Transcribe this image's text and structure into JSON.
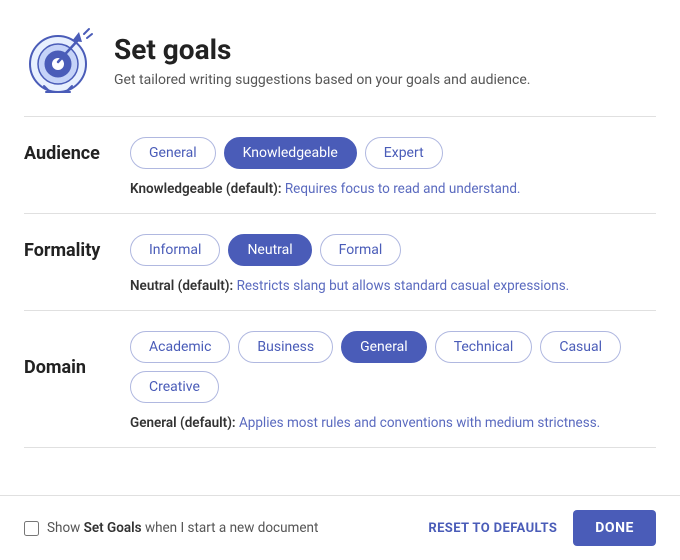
{
  "header": {
    "title": "Set goals",
    "subtitle": "Get tailored writing suggestions based on your goals and audience."
  },
  "audience": {
    "label": "Audience",
    "options": [
      "General",
      "Knowledgeable",
      "Expert"
    ],
    "selected": "Knowledgeable",
    "description_label": "Knowledgeable (default):",
    "description_text": " Requires focus to read and understand."
  },
  "formality": {
    "label": "Formality",
    "options": [
      "Informal",
      "Neutral",
      "Formal"
    ],
    "selected": "Neutral",
    "description_label": "Neutral (default):",
    "description_text": " Restricts slang but allows standard casual expressions."
  },
  "domain": {
    "label": "Domain",
    "options": [
      "Academic",
      "Business",
      "General",
      "Technical",
      "Casual",
      "Creative"
    ],
    "selected": "General",
    "description_label": "General (default):",
    "description_text": " Applies most rules and conventions with medium strictness."
  },
  "footer": {
    "checkbox_label": "Show ",
    "checkbox_bold": "Set Goals",
    "checkbox_suffix": " when I start a new document",
    "reset_label": "RESET TO DEFAULTS",
    "done_label": "DONE"
  },
  "icons": {
    "target": "target"
  }
}
